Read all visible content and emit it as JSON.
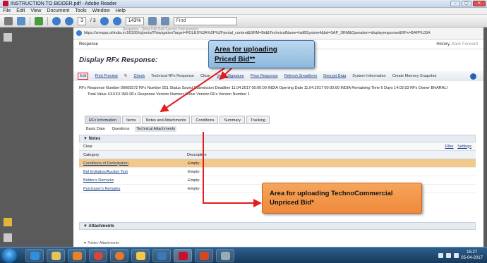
{
  "window": {
    "title": "INSTRUCTION TO BIDDER.pdf - Adobe Reader"
  },
  "menu": [
    "File",
    "Edit",
    "View",
    "Document",
    "Tools",
    "Window",
    "Help"
  ],
  "toolbar": {
    "page_current": "3",
    "page_total": "/ 3",
    "zoom": "143%",
    "find_placeholder": "Find"
  },
  "browser": {
    "portal_title": "Response - Sirna Drill Self-Service Procurement",
    "url": "https://srmqas.oilindia.in:50100/irj/portal?NavigationTarget=ROLES%3A%2F%2Fportal_content&SRM=Bid&TechnicalName=bidBSystem4&bd=SAP_SRM&Operation=displayresponse&RFx=BAPPL05A"
  },
  "response": {
    "label": "Response",
    "history": "History",
    "back": "Back",
    "forward": "Forward",
    "heading": "Display RFx Response:",
    "actions": {
      "edit": "Edit",
      "print_preview": "Print Preview",
      "check": "Check",
      "tech_rfx_response": "Technical RFx Response",
      "close": "Close",
      "verify_sign": "Verify Signature",
      "price_response": "Price Response",
      "refresh_smartform": "Refresh Smartform",
      "decrypt_data": "Decrypt Data",
      "system_info": "System Information",
      "create_snapshot": "Create Memory Snapshot"
    },
    "info_line1": "RFx Response Number  00605572     RFx Number  551     Status  Saved     Submission Deadline  11.04.2017 00:00:00 INDIA     Opening Date  11.04.2017 00:00:00 INDIA     Remaining Time  6 Days 14:02:03     RFx Owner  BHARALI",
    "info_line2": "Total Value  XXXXX INR     RFx Response Version Number  Active Version     RFx Version Number  1"
  },
  "tabs": [
    "RFx Information",
    "Items",
    "Notes and Attachments",
    "Conditions",
    "Summary",
    "Tracking"
  ],
  "subtabs": [
    "Basic Data",
    "Questions",
    "Technical Attachments"
  ],
  "notes": {
    "title": "Notes",
    "clear": "Clear",
    "filter": "Filter",
    "settings": "Settings",
    "col_category": "Category",
    "col_description": "Description",
    "rows": [
      {
        "category": "Conditions of Participation",
        "description": "-Empty-"
      },
      {
        "category": "Bid Invitation/Auction Text",
        "description": "-Empty-"
      },
      {
        "category": "Bidder's Remarks",
        "description": "-Empty-"
      },
      {
        "category": "Purchaser's Remarks",
        "description": "-Empty-"
      }
    ]
  },
  "attachments": {
    "title": "Attachments",
    "folder": "Folder: Attachments"
  },
  "callouts": {
    "priced_bid_line1": "Area for uploading",
    "priced_bid_line2": "Priced Bid**",
    "techno_line1": "Area for uploading TechnoCommercial",
    "techno_line2": "Unpriced Bid*"
  },
  "colors": {
    "highlight_row": "#f1c98c",
    "callout_blue": "#a7c9e7",
    "callout_orange": "#f29a4a",
    "arrow_red": "#e31b1b"
  },
  "taskbar": {
    "time": "15:27",
    "date": "05-04-2017"
  }
}
